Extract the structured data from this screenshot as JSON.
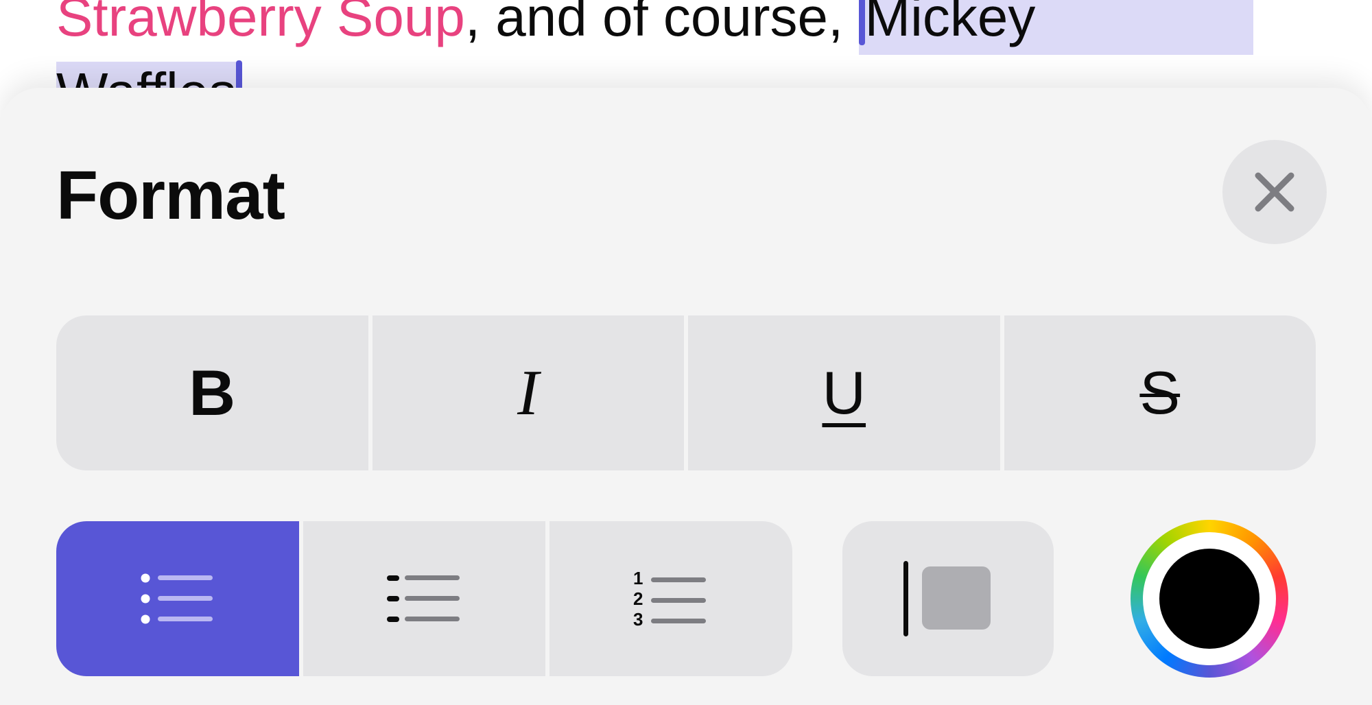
{
  "document": {
    "link_text": "Strawberry Soup",
    "middle_text": ", and of course, ",
    "selected_line1": "Mickey",
    "selected_line2": "Waffles"
  },
  "format_sheet": {
    "title": "Format",
    "close_icon": "close-icon",
    "text_styles": [
      {
        "label": "B",
        "icon": "bold-icon"
      },
      {
        "label": "I",
        "icon": "italic-icon"
      },
      {
        "label": "U",
        "icon": "underline-icon"
      },
      {
        "label": "S",
        "icon": "strikethrough-icon"
      }
    ],
    "list_styles": [
      {
        "icon": "bullet-list-icon",
        "active": true
      },
      {
        "icon": "dashed-list-icon",
        "active": false
      },
      {
        "icon": "numbered-list-icon",
        "active": false,
        "numbers": [
          "1",
          "2",
          "3"
        ]
      }
    ],
    "block_quote_icon": "block-quote-icon",
    "color_picker": {
      "icon": "color-wheel-icon",
      "selected_color": "#000000"
    }
  },
  "colors": {
    "accent": "#5856d6",
    "link": "#e8427f",
    "selection": "#dcdaf7",
    "button_bg": "#e4e4e6",
    "sheet_bg": "#f4f4f4"
  }
}
